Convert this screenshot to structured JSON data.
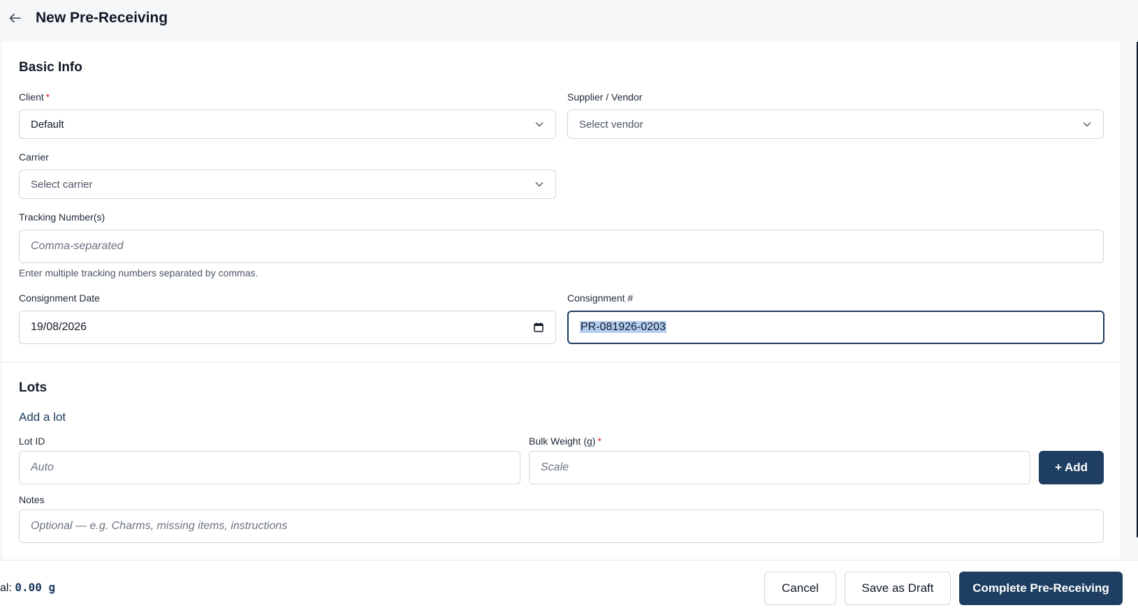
{
  "header": {
    "title": "New Pre-Receiving"
  },
  "basic_info": {
    "title": "Basic Info",
    "client": {
      "label": "Client",
      "required_mark": "*",
      "value": "Default"
    },
    "supplier": {
      "label": "Supplier / Vendor",
      "placeholder": "Select vendor"
    },
    "carrier": {
      "label": "Carrier",
      "placeholder": "Select carrier"
    },
    "tracking": {
      "label": "Tracking Number(s)",
      "placeholder": "Comma-separated",
      "hint": "Enter multiple tracking numbers separated by commas."
    },
    "consignment_date": {
      "label": "Consignment Date",
      "value": "19/08/2026"
    },
    "consignment_number": {
      "label": "Consignment #",
      "value": "PR-081926-0203"
    }
  },
  "lots": {
    "title": "Lots",
    "add_lot_label": "Add a lot",
    "lot_id": {
      "label": "Lot ID",
      "placeholder": "Auto"
    },
    "bulk_weight": {
      "label": "Bulk Weight (g)",
      "required_mark": "*",
      "placeholder": "Scale"
    },
    "add_button": "+ Add",
    "notes": {
      "label": "Notes",
      "placeholder": "Optional — e.g. Charms, missing items, instructions"
    }
  },
  "footer": {
    "total_prefix": "al: ",
    "total_value": "0.00 g",
    "cancel_label": "Cancel",
    "draft_label": "Save as Draft",
    "complete_label": "Complete Pre-Receiving"
  },
  "colors": {
    "primary": "#1e3f61",
    "required": "#dc2626",
    "selection": "#b4cdee"
  },
  "icons": {
    "back": "arrow-left-icon",
    "dropdown": "chevron-down-icon",
    "calendar": "calendar-icon"
  }
}
